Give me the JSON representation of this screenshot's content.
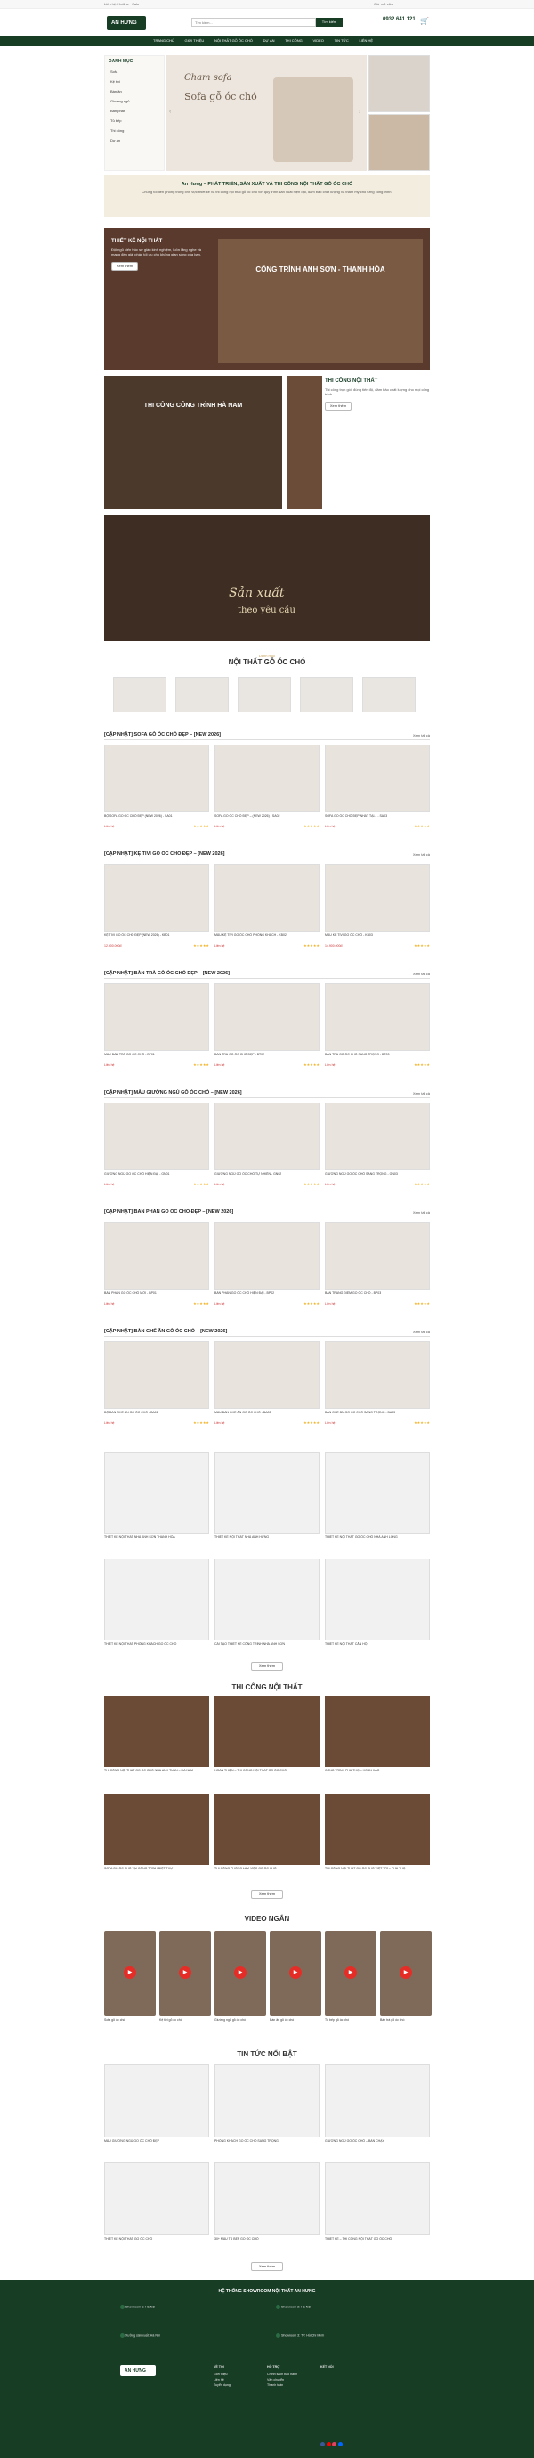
{
  "topbar": {
    "left": "Liên hệ: Hotline · Zalo",
    "right": "Giờ mở cửa"
  },
  "header": {
    "brand": "AN HƯNG",
    "search_placeholder": "Tìm kiếm...",
    "search_btn": "Tìm kiếm",
    "phone": "0932 641 121"
  },
  "nav": [
    "TRANG CHỦ",
    "GIỚI THIỆU",
    "NỘI THẤT GỖ ÓC CHÓ",
    "DỰ ÁN",
    "THI CÔNG",
    "VIDEO",
    "TIN TỨC",
    "LIÊN HỆ"
  ],
  "sidebar": {
    "title": "DANH MỤC",
    "items": [
      "Sofa",
      "Kệ tivi",
      "Bàn ăn",
      "Giường ngủ",
      "Bàn phấn",
      "Tủ bếp",
      "Thi công",
      "Dự án"
    ]
  },
  "hero": {
    "script": "Cham sofa",
    "title": "Sofa gỗ óc chó"
  },
  "intro": {
    "title": "An Hưng – PHÁT TRIỂN, SẢN XUẤT VÀ THI CÔNG NỘI THẤT GỖ ÓC CHÓ",
    "body": "Chúng tôi tiên phong trong lĩnh vực thiết kế và thi công nội thất gỗ óc chó với quy trình sản xuất hiện đại, đảm bảo chất lượng và thẩm mỹ cho từng công trình."
  },
  "design": {
    "title": "THIẾT KẾ NỘI THẤT",
    "body": "Đội ngũ kiến trúc sư giàu kinh nghiệm, luôn lắng nghe và mang đến giải pháp tối ưu cho không gian sống của bạn.",
    "btn": "Xem thêm",
    "banner": "CÔNG TRÌNH ANH SƠN - THANH HÓA"
  },
  "construction": {
    "title": "THI CÔNG NỘI THẤT",
    "body": "Thi công trọn gói, đúng tiến độ, đảm bảo chất lượng cho mọi công trình.",
    "btn": "Xem thêm",
    "banner": "THI CÔNG CÔNG TRÌNH HÀ NAM"
  },
  "production": {
    "script": "Sản xuất",
    "sub": "theo yêu cầu"
  },
  "catalog": {
    "eyebrow": "Danh mục",
    "title": "NỘI THẤT GỖ ÓC CHÓ"
  },
  "rows": [
    {
      "title": "[CẬP NHẬT] SOFA GỖ ÓC CHÓ ĐẸP – [NEW 2026]",
      "more": "Xem tất cả",
      "items": [
        {
          "name": "BỘ SOFA GỖ ÓC CHÓ ĐẸP (NEW 2026) - SA01",
          "price": "Liên hệ"
        },
        {
          "name": "SOFA GỖ ÓC CHÓ ĐẸP – (NEW 2026) - SA02",
          "price": "Liên hệ"
        },
        {
          "name": "SOFA GỖ ÓC CHÓ ĐẸP NHẤT TẠI... - SA03",
          "price": "Liên hệ"
        }
      ]
    },
    {
      "title": "[CẬP NHẬT] KỆ TIVI GỖ ÓC CHÓ ĐẸP – [NEW 2026]",
      "more": "Xem tất cả",
      "items": [
        {
          "name": "KỆ TIVI GỖ ÓC CHÓ ĐẸP (NEW 2026) - KB01",
          "price": "12.900.000đ"
        },
        {
          "name": "MẪU KỆ TIVI GỖ ÓC CHÓ PHÒNG KHÁCH - KB02",
          "price": "Liên hệ"
        },
        {
          "name": "MẪU KỆ TIVI GỖ ÓC CHÓ - KB03",
          "price": "14.900.000đ"
        }
      ]
    },
    {
      "title": "[CẬP NHẬT] BÀN TRÀ GỖ ÓC CHÓ ĐẸP – [NEW 2026]",
      "more": "Xem tất cả",
      "items": [
        {
          "name": "MẪU BÀN TRÀ GỖ ÓC CHÓ - BT01",
          "price": "Liên hệ"
        },
        {
          "name": "BÀN TRÀ GỖ ÓC CHÓ ĐẸP - BT02",
          "price": "Liên hệ"
        },
        {
          "name": "BÀN TRÀ GỖ ÓC CHÓ SANG TRỌNG - BT03",
          "price": "Liên hệ"
        }
      ]
    },
    {
      "title": "[CẬP NHẬT] MẪU GIƯỜNG NGỦ GỖ ÓC CHÓ – [NEW 2026]",
      "more": "Xem tất cả",
      "items": [
        {
          "name": "GIƯỜNG NGỦ GỖ ÓC CHÓ HIỆN ĐẠI - GN01",
          "price": "Liên hệ"
        },
        {
          "name": "GIƯỜNG NGỦ GỖ ÓC CHÓ TỰ NHIÊN - GN02",
          "price": "Liên hệ"
        },
        {
          "name": "GIƯỜNG NGỦ GỖ ÓC CHÓ SANG TRỌNG - GN03",
          "price": "Liên hệ"
        }
      ]
    },
    {
      "title": "[CẬP NHẬT] BÀN PHẤN GỖ ÓC CHÓ ĐẸP – [NEW 2026]",
      "more": "Xem tất cả",
      "items": [
        {
          "name": "BÀN PHẤN GỖ ÓC CHÓ MỚI - BP01",
          "price": "Liên hệ"
        },
        {
          "name": "BÀN PHẤN GỖ ÓC CHÓ HIỆN ĐẠI - BP02",
          "price": "Liên hệ"
        },
        {
          "name": "BÀN TRANG ĐIỂM GỖ ÓC CHÓ - BP03",
          "price": "Liên hệ"
        }
      ]
    },
    {
      "title": "[CẬP NHẬT] BÀN GHẾ ĂN GỖ ÓC CHÓ – [NEW 2026]",
      "more": "Xem tất cả",
      "items": [
        {
          "name": "BỘ BÀN GHẾ ĂN GỖ ÓC CHÓ - BA01",
          "price": "Liên hệ"
        },
        {
          "name": "MẪU BÀN GHẾ ĂN GỖ ÓC CHÓ - BA02",
          "price": "Liên hệ"
        },
        {
          "name": "BÀN GHẾ ĂN GỖ ÓC CHÓ SANG TRỌNG - BA03",
          "price": "Liên hệ"
        }
      ]
    }
  ],
  "projects": {
    "items": [
      "THIẾT KẾ NỘI THẤT NHÀ ANH SƠN THANH HÓA",
      "THIẾT KẾ NỘI THẤT NHÀ ANH HƯNG",
      "THIẾT KẾ NỘI THẤT GỖ ÓC CHÓ NHÀ ANH LONG",
      "THIẾT KẾ NỘI THẤT PHÒNG KHÁCH GỖ ÓC CHÓ",
      "CẢI TẠO THIẾT KẾ CÔNG TRÌNH NHÀ ANH SƠN",
      "THIẾT KẾ NỘI THẤT CĂN HỘ"
    ],
    "btn": "Xem thêm"
  },
  "thicong": {
    "title": "THI CÔNG NỘI THẤT",
    "items": [
      "THI CÔNG NỘI THẤT GỖ ÓC CHÓ NHÀ ANH TUẤN – HÀ NAM",
      "HOÀN THIỆN – THI CÔNG NỘI THẤT GỖ ÓC CHÓ",
      "CÔNG TRÌNH PHÚ THỌ – HOÀN HẢO",
      "SOFA GỖ ÓC CHÓ TẠI CÔNG TRÌNH BIỆT THỰ",
      "THI CÔNG PHÒNG LÀM VIỆC GỖ ÓC CHÓ",
      "THI CÔNG NỘI THẤT GỖ ÓC CHÓ VIỆT TRÌ – PHÚ THỌ"
    ],
    "btn": "Xem thêm"
  },
  "video": {
    "title": "VIDEO NGẮN",
    "items": [
      "Sofa gỗ óc chó",
      "Kệ tivi gỗ óc chó",
      "Giường ngủ gỗ óc chó",
      "Bàn ăn gỗ óc chó",
      "Tủ bếp gỗ óc chó",
      "Bàn trà gỗ óc chó"
    ]
  },
  "news": {
    "title": "TIN TỨC NỔI BẬT",
    "items": [
      "MẪU GIƯỜNG NGỦ GỖ ÓC CHÓ ĐẸP",
      "PHÒNG KHÁCH GỖ ÓC CHÓ SANG TRỌNG",
      "GIƯỜNG NGỦ GỖ ÓC CHÓ – BÁN CHẠY",
      "THIẾT KẾ NỘI THẤT GỖ ÓC CHÓ",
      "30+ MẪU TỦ BẾP GỖ ÓC CHÓ",
      "THIẾT KẾ – THI CÔNG NỘI THẤT GỖ ÓC CHÓ"
    ],
    "btn": "Xem thêm"
  },
  "footer": {
    "heading": "HỆ THỐNG SHOWROOM NỘI THẤT AN HƯNG",
    "addr1": "Showroom 1: Hà Nội",
    "addr2": "Showroom 2: Hà Nội",
    "addr3": "Xưởng sản xuất: Hà Nội",
    "addr4": "Showroom 3: TP. Hồ Chí Minh",
    "brand": "AN HƯNG",
    "col1": "VỀ TÔI",
    "col2": "HỖ TRỢ",
    "col3": "KẾT NỐI",
    "c1": [
      "Giới thiệu",
      "Liên hệ",
      "Tuyển dụng"
    ],
    "c2": [
      "Chính sách bảo hành",
      "Vận chuyển",
      "Thanh toán"
    ]
  }
}
